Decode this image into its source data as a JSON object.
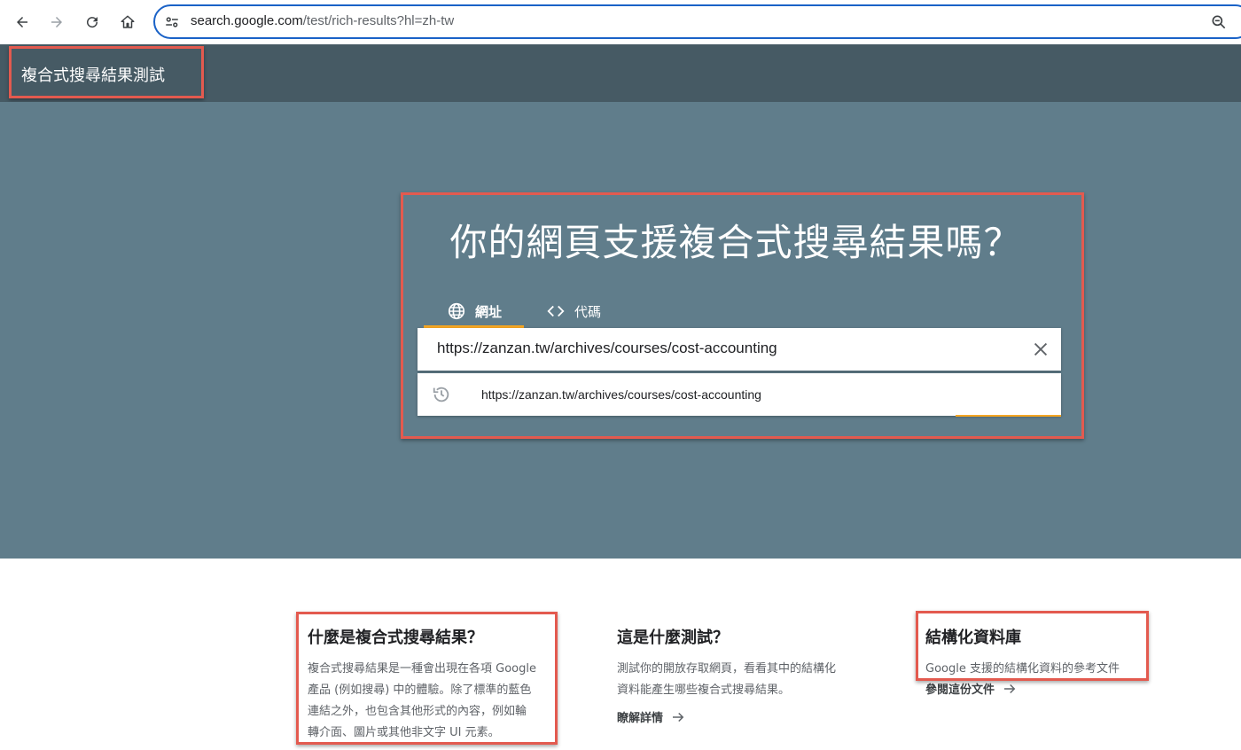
{
  "browser": {
    "url_host": "search.google.com",
    "url_path": "/test/rich-results?hl=zh-tw"
  },
  "header": {
    "title": "複合式搜尋結果測試"
  },
  "hero": {
    "heading": "你的網頁支援複合式搜尋結果嗎？",
    "tabs": [
      {
        "label": "網址",
        "icon": "globe-icon",
        "active": true
      },
      {
        "label": "代碼",
        "icon": "code-icon",
        "active": false
      }
    ],
    "url_input_value": "https://zanzan.tw/archives/courses/cost-accounting",
    "suggestion": "https://zanzan.tw/archives/courses/cost-accounting"
  },
  "info": [
    {
      "title": "什麼是複合式搜尋結果？",
      "lines": [
        "複合式搜尋結果是一種會出現在各項 Google",
        "產品 (例如搜尋) 中的體驗。除了標準的藍色",
        "連結之外，也包含其他形式的內容，例如輪",
        "轉介面、圖片或其他非文字 UI 元素。"
      ]
    },
    {
      "title": "這是什麼測試？",
      "lines": [
        "測試你的開放存取網頁，看看其中的結構化",
        "資料能產生哪些複合式搜尋結果。"
      ],
      "link": "瞭解詳情"
    },
    {
      "title": "結構化資料庫",
      "lines": [
        "Google 支援的結構化資料的參考文件"
      ],
      "link": "參閱這份文件"
    }
  ],
  "colors": {
    "header_bg": "#465a64",
    "hero_bg": "#607d8b",
    "tab_accent": "#f5a623",
    "annotation": "#e35a4f",
    "omnibox_border": "#1a62c7"
  }
}
